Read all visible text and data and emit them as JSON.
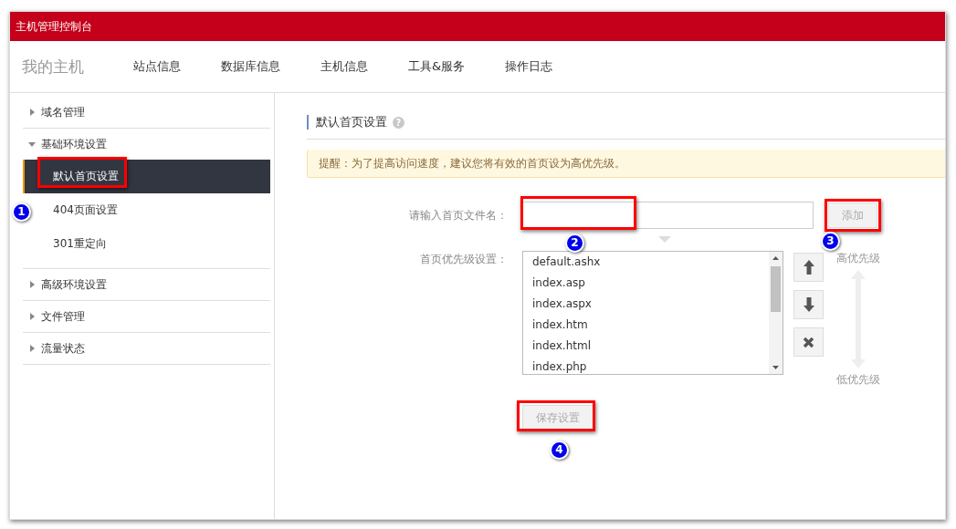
{
  "header": {
    "title": "主机管理控制台"
  },
  "nav": {
    "brand": "我的主机",
    "items": [
      {
        "label": "站点信息",
        "selected": false
      },
      {
        "label": "数据库信息",
        "selected": false
      },
      {
        "label": "主机信息",
        "selected": false
      },
      {
        "label": "工具&服务",
        "selected": false
      },
      {
        "label": "操作日志",
        "selected": false
      }
    ]
  },
  "sidebar": {
    "groups": [
      {
        "label": "域名管理",
        "expanded": false
      },
      {
        "label": "基础环境设置",
        "expanded": true,
        "children": [
          {
            "label": "默认首页设置",
            "selected": true,
            "callout": "1"
          },
          {
            "label": "404页面设置",
            "selected": false
          },
          {
            "label": "301重定向",
            "selected": false
          }
        ]
      },
      {
        "label": "高级环境设置",
        "expanded": false
      },
      {
        "label": "文件管理",
        "expanded": false
      },
      {
        "label": "流量状态",
        "expanded": false
      }
    ]
  },
  "page": {
    "title": "默认首页设置",
    "help_icon": "?",
    "notice": "提醒：为了提高访问速度，建议您将有效的首页设为高优先级。"
  },
  "form": {
    "filename_label": "请输入首页文件名：",
    "filename_callout": "2",
    "add_button": {
      "label": "添加",
      "disabled": true,
      "callout": "3"
    },
    "priority_label": "首页优先级设置：",
    "files": [
      "default.ashx",
      "index.asp",
      "index.aspx",
      "index.htm",
      "index.html",
      "index.php"
    ],
    "high_label": "高优先级",
    "low_label": "低优先级",
    "save_button": {
      "label": "保存设置",
      "disabled": true,
      "callout": "4"
    }
  }
}
